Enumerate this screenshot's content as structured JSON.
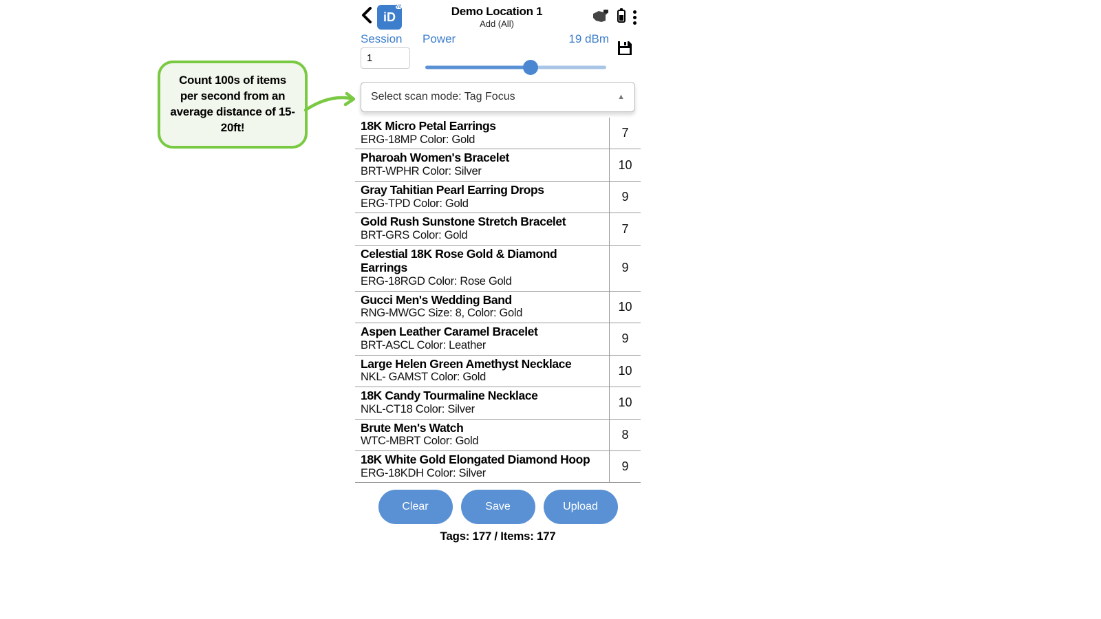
{
  "header": {
    "title": "Demo Location 1",
    "sub": "Add (All)",
    "logo_text": "iD"
  },
  "session": {
    "label": "Session",
    "value": "1"
  },
  "power": {
    "label": "Power",
    "value": "19 dBm"
  },
  "scan_mode": {
    "prefix": "Select scan mode:",
    "value": "Tag Focus",
    "combined": "Select scan mode:  Tag Focus"
  },
  "items": [
    {
      "title": "18K Micro Petal Earrings",
      "sub": "ERG-18MP Color: Gold",
      "count": "7"
    },
    {
      "title": "Pharoah Women's Bracelet",
      "sub": "BRT-WPHR Color: Silver",
      "count": "10"
    },
    {
      "title": "Gray Tahitian Pearl Earring Drops",
      "sub": "ERG-TPD Color: Gold",
      "count": "9"
    },
    {
      "title": "Gold Rush Sunstone Stretch Bracelet",
      "sub": "BRT-GRS Color: Gold",
      "count": "7"
    },
    {
      "title": "Celestial 18K Rose Gold & Diamond Earrings",
      "sub": "ERG-18RGD Color: Rose Gold",
      "count": "9"
    },
    {
      "title": "Gucci Men's Wedding Band",
      "sub": "RNG-MWGC Size: 8, Color: Gold",
      "count": "10"
    },
    {
      "title": "Aspen Leather Caramel Bracelet",
      "sub": "BRT-ASCL Color: Leather",
      "count": "9"
    },
    {
      "title": "Large Helen Green Amethyst Necklace",
      "sub": "NKL- GAMST Color: Gold",
      "count": "10"
    },
    {
      "title": "18K Candy Tourmaline Necklace",
      "sub": "NKL-CT18 Color: Silver",
      "count": "10"
    },
    {
      "title": "Brute Men's Watch",
      "sub": "WTC-MBRT Color: Gold",
      "count": "8"
    },
    {
      "title": "18K White Gold Elongated Diamond Hoop",
      "sub": "ERG-18KDH Color: Silver",
      "count": "9"
    }
  ],
  "buttons": {
    "clear": "Clear",
    "save": "Save",
    "upload": "Upload"
  },
  "status_line": "Tags: 177 / Items: 177",
  "callout_text": "Count 100s of items per second from an average distance of 15-20ft!",
  "colors": {
    "accent": "#3d7ecc",
    "button": "#5a91d4",
    "callout_border": "#7ac943",
    "callout_bg": "#f1f7ec"
  }
}
